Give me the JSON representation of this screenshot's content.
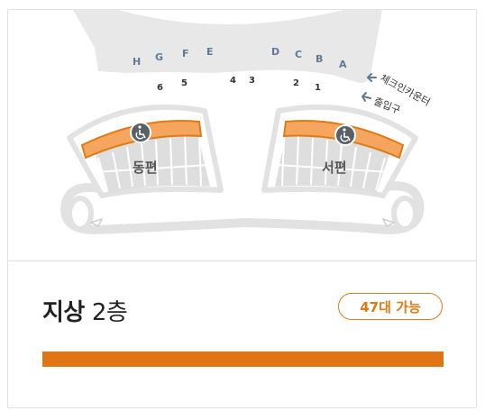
{
  "map": {
    "gates": [
      "H",
      "G",
      "F",
      "E",
      "D",
      "C",
      "B",
      "A"
    ],
    "gate_numbers": [
      "6",
      "5",
      "4",
      "3",
      "2",
      "1"
    ],
    "checkin_label": "체크인카운터",
    "entrance_label": "출입구",
    "east_zone_label": "동편",
    "west_zone_label": "서편"
  },
  "info": {
    "floor_name": "지상",
    "floor_number": "2층",
    "availability_label": "47대 가능",
    "availability_ratio": 1.0
  },
  "colors": {
    "accent": "#df7513",
    "zone_gray": "#dedede",
    "gate_text": "#5f7a96"
  }
}
